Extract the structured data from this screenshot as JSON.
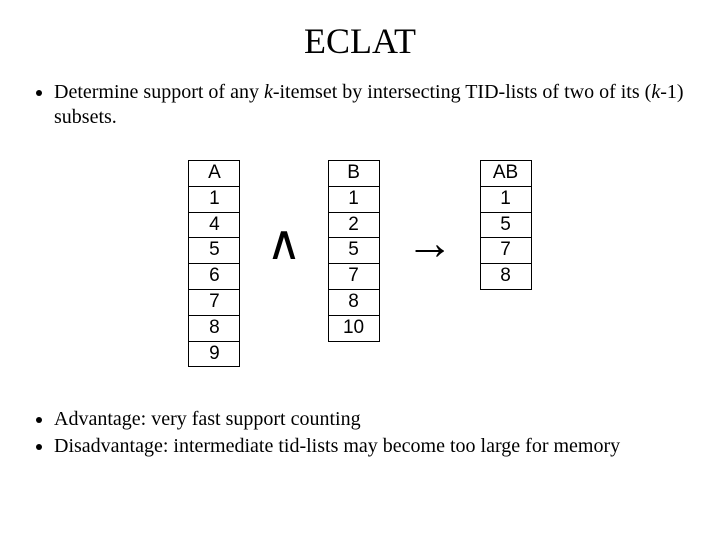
{
  "title": "ECLAT",
  "bullet_top": {
    "prefix": "Determine support of any ",
    "k_ital": "k",
    "mid": "-itemset by intersecting TID-lists of two of its (",
    "km1_ital": "k",
    "suffix": "-1) subsets."
  },
  "tables": {
    "A": {
      "header": "A",
      "rows": [
        "1",
        "4",
        "5",
        "6",
        "7",
        "8",
        "9"
      ]
    },
    "B": {
      "header": "B",
      "rows": [
        "1",
        "2",
        "5",
        "7",
        "8",
        "10"
      ]
    },
    "AB": {
      "header": "AB",
      "rows": [
        "1",
        "5",
        "7",
        "8"
      ]
    }
  },
  "ops": {
    "and": "∧",
    "arrow": "→"
  },
  "bullets_bottom": [
    "Advantage: very fast support counting",
    "Disadvantage: intermediate tid-lists may become too large for memory"
  ]
}
